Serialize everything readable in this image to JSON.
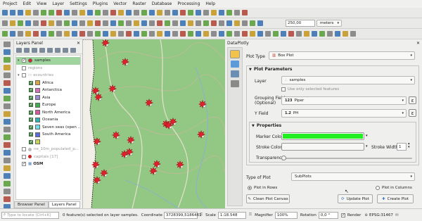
{
  "menu": [
    "Project",
    "Edit",
    "View",
    "Layer",
    "Settings",
    "Plugins",
    "Vector",
    "Raster",
    "Database",
    "Processing",
    "Help"
  ],
  "toolbar": {
    "scale_value": "250,00",
    "units": "meters"
  },
  "layers_panel": {
    "title": "Layers Panel",
    "close": "✕",
    "items": [
      {
        "label": "samples",
        "indent": 1,
        "checked": true,
        "selected": true,
        "swatch": "#e0202a"
      },
      {
        "label": "regions",
        "indent": 1,
        "checked": false,
        "dim": true
      },
      {
        "label": "ecountries",
        "indent": 1,
        "checked": false,
        "dim": true,
        "group": true
      },
      {
        "label": "Africa",
        "indent": 2,
        "checked": true,
        "swatch": "#d9a441"
      },
      {
        "label": "Antarctica",
        "indent": 2,
        "checked": true,
        "swatch": "#d86fb7"
      },
      {
        "label": "Asia",
        "indent": 2,
        "checked": true,
        "swatch": "#9b8ad3"
      },
      {
        "label": "Europe",
        "indent": 2,
        "checked": true,
        "swatch": "#3cb14b"
      },
      {
        "label": "North America",
        "indent": 2,
        "checked": true,
        "swatch": "#d9579d"
      },
      {
        "label": "Oceania",
        "indent": 2,
        "checked": true,
        "swatch": "#2db1b5"
      },
      {
        "label": "Seven seas (open ...",
        "indent": 2,
        "checked": true,
        "swatch": "#6fe0ea"
      },
      {
        "label": "South America",
        "indent": 2,
        "checked": true,
        "swatch": "#5a6be0"
      },
      {
        "label": "",
        "indent": 2,
        "checked": true,
        "swatch": "#c9d45a"
      },
      {
        "label": "ne_10m_populated_p...",
        "indent": 1,
        "checked": false,
        "dim": true,
        "dot": "#bbbbbb"
      },
      {
        "label": "capitals [17]",
        "indent": 1,
        "checked": false,
        "dim": true,
        "dot": "#cc2222"
      },
      {
        "label": "OSM",
        "indent": 1,
        "checked": true,
        "bold": true
      }
    ]
  },
  "bottom_tabs": [
    "Browser Panel",
    "Layers Panel"
  ],
  "dataplotly": {
    "title": "DataPlotly",
    "plot_type_label": "Plot Type",
    "plot_type_value": "Box Plot",
    "plot_params_title": "Plot Parameters",
    "layer_label": "Layer",
    "layer_value": "samples",
    "use_selected": "Use only selected features",
    "grouping_label": "Grouping Field",
    "grouping_sub": "(Optional)",
    "grouping_value": "Piper",
    "grouping_prefix": "123",
    "y_label": "Y Field",
    "y_value": "PH",
    "y_prefix": "1.2",
    "properties_title": "Properties",
    "marker_color_label": "Marker Color",
    "marker_color": "#22ee22",
    "stroke_color_label": "Stroke Color",
    "stroke_width_label": "Stroke Width",
    "stroke_width_value": "1",
    "transparency_label": "Transparency",
    "type_of_plot_label": "Type of Plot",
    "type_of_plot_value": "SubPlots",
    "plot_in_rows": "Plot in Rows",
    "plot_in_columns": "Plot in Columns",
    "clean_button": "Clean Plot Canvas",
    "update_button": "Update Plot",
    "create_button": "Create Plot",
    "close": "✕"
  },
  "status": {
    "search_placeholder": "Type to locate (Ctrl+K)",
    "message": "0 feature(s) selected on layer samples.",
    "coordinate_label": "Coordinate",
    "coordinate_value": "3728399,5186461",
    "scale_label": "Scale",
    "scale_value": "1:18.548",
    "magnifier_label": "Magnifier",
    "magnifier_value": "100%",
    "rotation_label": "Rotation",
    "rotation_value": "0,0 °",
    "render_label": "Render",
    "crs": "EPSG:31467"
  },
  "colors": {
    "accent_green": "#9fd49f",
    "map_green": "#8fc57f",
    "marker_red": "#e0202a"
  }
}
